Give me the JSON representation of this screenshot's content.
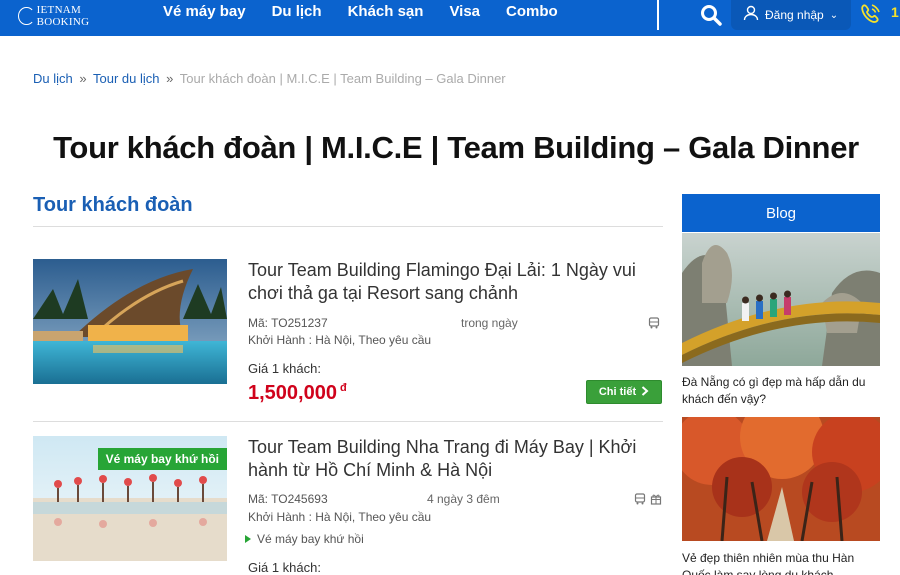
{
  "header": {
    "logo_text": "IETNAM BOOKING",
    "nav": [
      "Vé máy bay",
      "Du lịch",
      "Khách sạn",
      "Visa",
      "Combo"
    ],
    "login_label": "Đăng nhập",
    "phone_partial": "1",
    "colors": {
      "bar": "#0b63ce",
      "accent": "#f5e12a"
    }
  },
  "breadcrumb": {
    "items": [
      "Du lịch",
      "Tour du lịch"
    ],
    "separator": "»",
    "current": "Tour khách đoàn | M.I.C.E | Team Building – Gala Dinner"
  },
  "page_title": "Tour khách đoàn | M.I.C.E | Team Building – Gala Dinner",
  "section_title": "Tour khách đoàn",
  "tours": [
    {
      "title": "Tour Team Building Flamingo Đại Lải: 1 Ngày vui chơi thả ga tại Resort sang chảnh",
      "code": "Mã: TO251237",
      "duration": "trong ngày",
      "departure": "Khởi Hành : Hà Nội, Theo yêu cầu",
      "price_label": "Giá 1 khách:",
      "price": "1,500,000",
      "currency": "đ",
      "detail_label": "Chi tiết",
      "transport_icons": [
        "bus-icon"
      ]
    },
    {
      "title": "Tour Team Building Nha Trang đi Máy Bay | Khởi hành từ Hồ Chí Minh & Hà Nội",
      "code": "Mã: TO245693",
      "duration": "4 ngày 3 đêm",
      "departure": "Khởi Hành : Hà Nội, Theo yêu cầu",
      "ribbon": "Vé máy bay khứ hồi",
      "feature": "Vé máy bay khứ hồi",
      "price_label": "Giá 1 khách:",
      "transport_icons": [
        "bus-icon",
        "gift-icon"
      ]
    }
  ],
  "sidebar": {
    "title": "Blog",
    "posts": [
      {
        "caption": "Đà Nẵng có gì đẹp mà hấp dẫn du khách đến vậy?"
      },
      {
        "caption": "Vẻ đẹp thiên nhiên mùa thu Hàn Quốc làm say lòng du khách"
      }
    ]
  }
}
